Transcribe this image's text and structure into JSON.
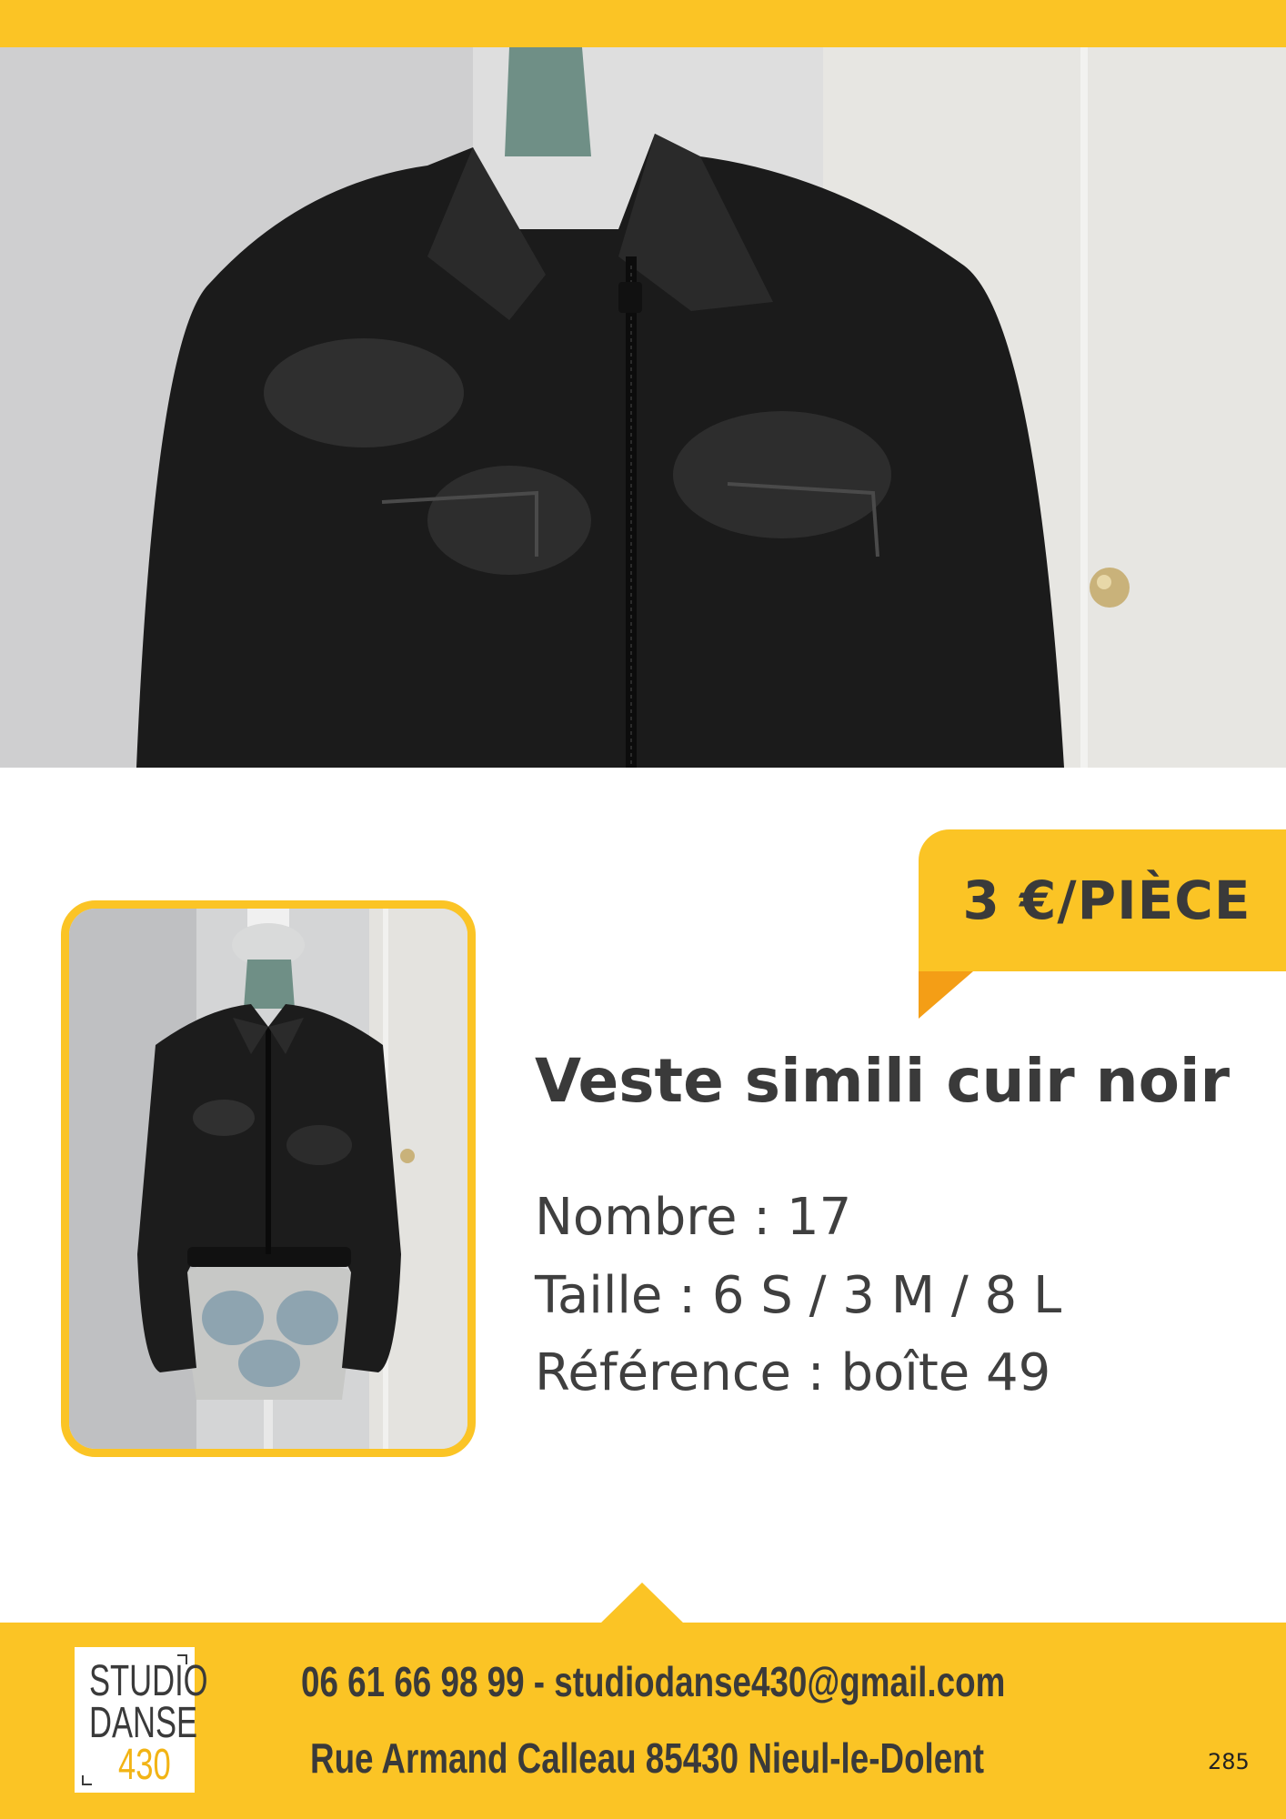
{
  "price": {
    "label": "3 €/PIÈCE"
  },
  "product": {
    "title": "Veste simili cuir noir",
    "quantity": "Nombre : 17",
    "sizes": "Taille : 6 S / 3 M / 8 L",
    "reference": "Référence : boîte 49"
  },
  "images": {
    "hero": "black-jacket-closeup-photo",
    "thumbnail": "black-jacket-on-mannequin-photo"
  },
  "footer": {
    "contact": "06 61 66 98 99 - studiodanse430@gmail.com",
    "address": "Rue Armand Calleau 85430 Nieul-le-Dolent",
    "logo": {
      "line1": "STUDIO",
      "line2": "DANSE",
      "line3": "430"
    },
    "page_number": "285"
  },
  "colors": {
    "brand_yellow": "#fbc425",
    "fold_orange": "#f49e16",
    "text_dark": "#3a3a3a"
  }
}
